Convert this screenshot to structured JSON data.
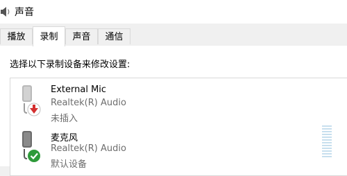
{
  "window": {
    "title": "声音"
  },
  "tabs": [
    {
      "label": "播放"
    },
    {
      "label": "录制"
    },
    {
      "label": "声音"
    },
    {
      "label": "通信"
    }
  ],
  "active_tab": "录制",
  "instruction": "选择以下录制设备来修改设置:",
  "devices": [
    {
      "name": "External Mic",
      "driver": "Realtek(R) Audio",
      "status": "未插入",
      "status_icon": "unplugged-red-arrow-icon"
    },
    {
      "name": "麦克风",
      "driver": "Realtek(R) Audio",
      "status": "默认设备",
      "status_icon": "default-green-check-icon"
    }
  ],
  "colors": {
    "unplugged_badge": "#d32f2f",
    "default_badge": "#2e9a3a",
    "level_meter": "#c7dfee"
  }
}
